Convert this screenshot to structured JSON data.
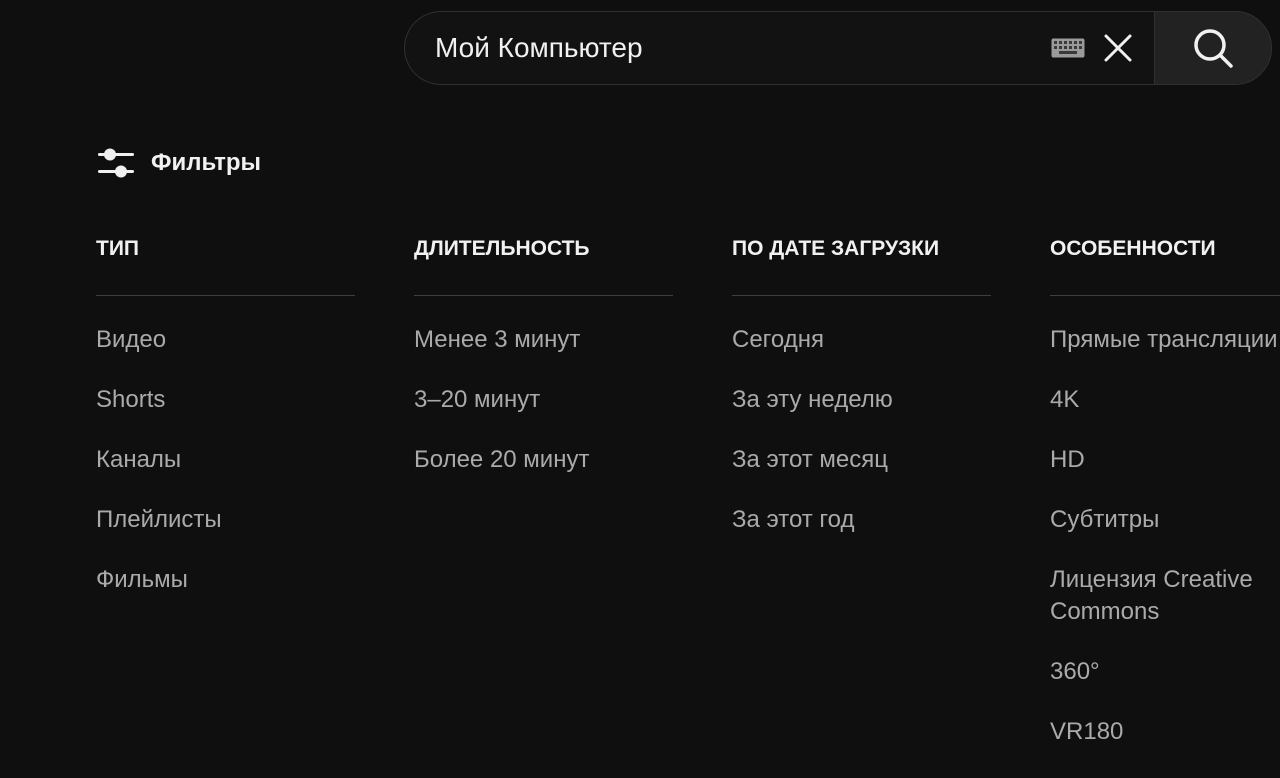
{
  "search": {
    "query": "Мой Компьютер",
    "keyboard_icon": "keyboard-icon",
    "clear_icon": "close-icon",
    "submit_icon": "search-icon"
  },
  "filters": {
    "label": "Фильтры",
    "icon": "tune-icon",
    "groups": [
      {
        "title": "ТИП",
        "options": [
          "Видео",
          "Shorts",
          "Каналы",
          "Плейлисты",
          "Фильмы"
        ]
      },
      {
        "title": "ДЛИТЕЛЬНОСТЬ",
        "options": [
          "Менее 3 минут",
          "3–20 минут",
          "Более 20 минут"
        ]
      },
      {
        "title": "ПО ДАТЕ ЗАГРУЗКИ",
        "options": [
          "Сегодня",
          "За эту неделю",
          "За этот месяц",
          "За этот год"
        ]
      },
      {
        "title": "ОСОБЕННОСТИ",
        "options": [
          "Прямые трансляции",
          "4K",
          "HD",
          "Субтитры",
          "Лицензия Creative Commons",
          "360°",
          "VR180"
        ]
      }
    ]
  },
  "colors": {
    "background": "#0f0f0f",
    "text_primary": "#f1f1f1",
    "text_secondary": "#aaaaaa",
    "divider": "#3f3f3f",
    "search_button_bg": "#222222"
  }
}
